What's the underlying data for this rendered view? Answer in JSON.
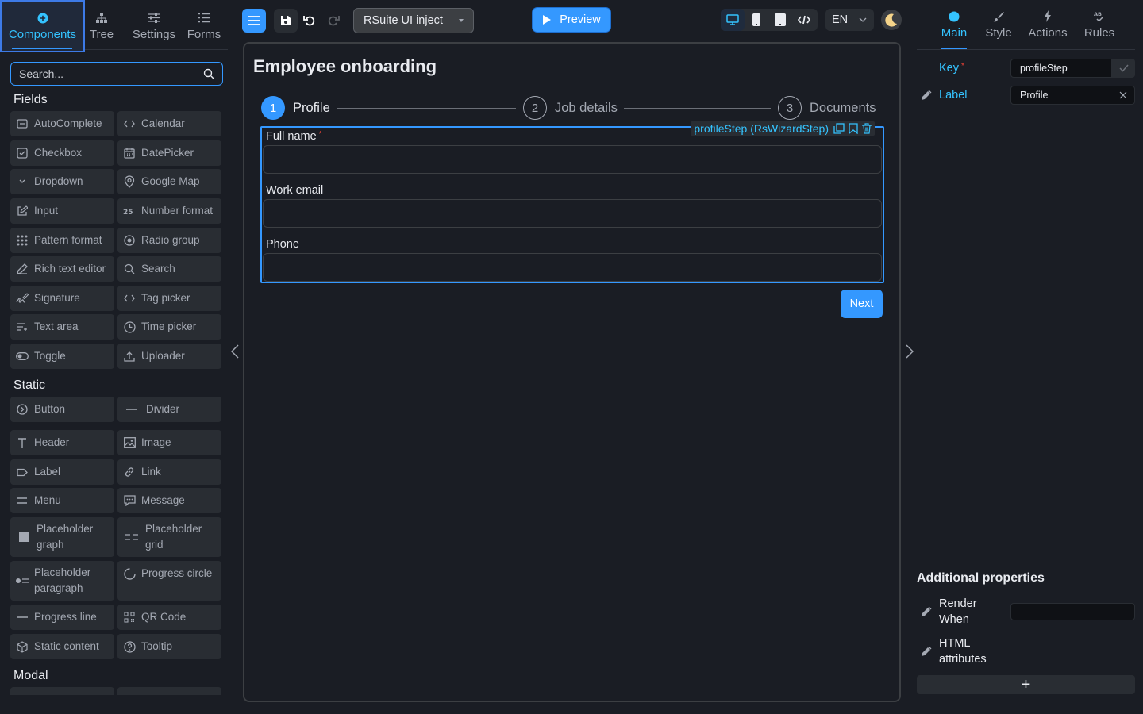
{
  "left_tabs": [
    {
      "label": "Components",
      "icon": "plus-circle-icon"
    },
    {
      "label": "Tree",
      "icon": "tree-icon"
    },
    {
      "label": "Settings",
      "icon": "sliders-icon"
    },
    {
      "label": "Forms",
      "icon": "list-icon"
    }
  ],
  "search": {
    "placeholder": "Search..."
  },
  "sections": {
    "fields": "Fields",
    "static": "Static",
    "modal": "Modal"
  },
  "fields": [
    "AutoComplete",
    "Calendar",
    "Checkbox",
    "DatePicker",
    "Dropdown",
    "Google Map",
    "Input",
    "Number format",
    "Pattern format",
    "Radio group",
    "Rich text editor",
    "Search",
    "Signature",
    "Tag picker",
    "Text area",
    "Time picker",
    "Toggle",
    "Uploader"
  ],
  "statics": [
    "Button",
    "Divider",
    "Header",
    "Image",
    "Label",
    "Link",
    "Menu",
    "Message",
    "Placeholder graph",
    "Placeholder grid",
    "Placeholder paragraph",
    "Progress circle",
    "Progress line",
    "QR Code",
    "Static content",
    "Tooltip"
  ],
  "toolbar": {
    "project": "RSuite UI inject",
    "preview": "Preview",
    "language": "EN"
  },
  "form": {
    "title": "Employee onboarding",
    "steps": [
      {
        "number": "1",
        "label": "Profile"
      },
      {
        "number": "2",
        "label": "Job details"
      },
      {
        "number": "3",
        "label": "Documents"
      }
    ],
    "wizard_tag": "profileStep (RsWizardStep)",
    "fields": [
      {
        "label": "Full name",
        "required": "*"
      },
      {
        "label": "Work email"
      },
      {
        "label": "Phone"
      }
    ],
    "next": "Next"
  },
  "right_tabs": [
    {
      "label": "Main"
    },
    {
      "label": "Style"
    },
    {
      "label": "Actions"
    },
    {
      "label": "Rules"
    }
  ],
  "props": {
    "key_label": "Key",
    "key_required": "*",
    "key_value": "profileStep",
    "label_label": "Label",
    "label_value": "Profile"
  },
  "additional": {
    "title": "Additional properties",
    "render_when": "Render When",
    "html_attributes": "HTML attributes",
    "add": "+"
  },
  "colors": {
    "accent": "#3498ff",
    "accent_text": "#34c3ff",
    "required": "#f44336"
  }
}
